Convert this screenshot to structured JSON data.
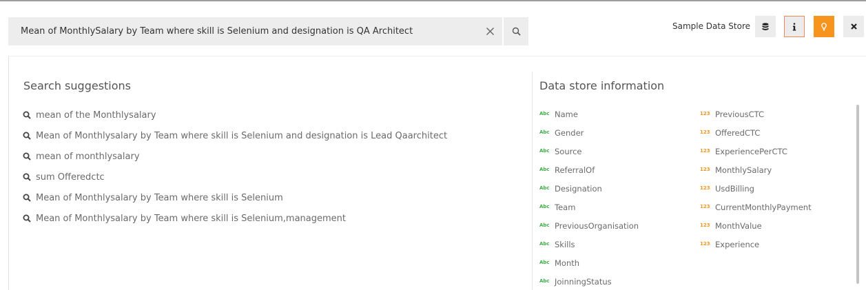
{
  "search": {
    "query": "Mean of MonthlySalary by Team where skill is Selenium and designation is QA Architect"
  },
  "toolbar": {
    "store_label": "Sample Data Store",
    "bulb_color": "#f7941d",
    "active_outline_color": "#f08a5d"
  },
  "suggestions": {
    "title": "Search suggestions",
    "items": [
      "mean of the Monthlysalary",
      "Mean of Monthlysalary by Team where skill is Selenium and designation is Lead Qaarchitect",
      "mean of monthlysalary",
      "sum Offeredctc",
      "Mean of Monthlysalary by Team where skill is Selenium",
      "Mean of Monthlysalary by Team where skill is Selenium,management"
    ]
  },
  "datastore": {
    "title": "Data store information",
    "text_tag": "Abc",
    "number_tag": "123",
    "text_color": "#3fae49",
    "number_color": "#f7941d",
    "text_fields": [
      "Name",
      "Gender",
      "Source",
      "ReferralOf",
      "Designation",
      "Team",
      "PreviousOrganisation",
      "Skills",
      "Month",
      "JoinningStatus"
    ],
    "number_fields": [
      "PreviousCTC",
      "OfferedCTC",
      "ExperiencePerCTC",
      "MonthlySalary",
      "UsdBilling",
      "CurrentMonthlyPayment",
      "MonthValue",
      "Experience"
    ]
  }
}
